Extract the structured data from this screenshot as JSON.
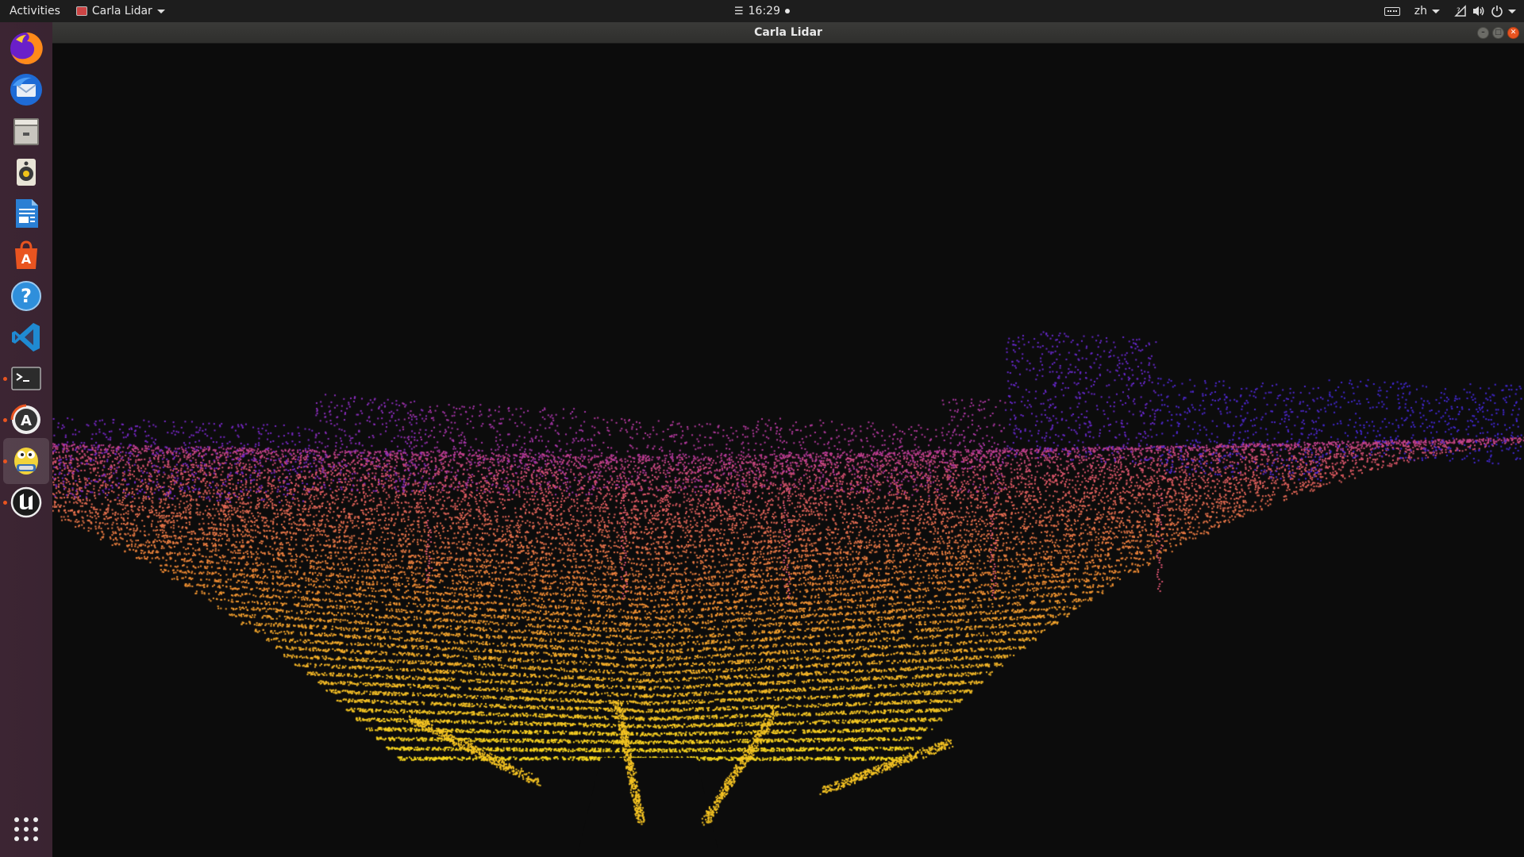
{
  "topbar": {
    "activities_label": "Activities",
    "app_menu_label": "Carla Lidar",
    "clock": "16:29",
    "language": "zh"
  },
  "window": {
    "title": "Carla Lidar"
  },
  "dock": {
    "items": [
      {
        "name": "firefox-icon",
        "running": false
      },
      {
        "name": "thunderbird-icon",
        "running": false
      },
      {
        "name": "files-icon",
        "running": false
      },
      {
        "name": "rhythmbox-icon",
        "running": false
      },
      {
        "name": "libreoffice-writer-icon",
        "running": false
      },
      {
        "name": "ubuntu-software-icon",
        "running": false
      },
      {
        "name": "help-icon",
        "running": false
      },
      {
        "name": "vscode-icon",
        "running": false
      },
      {
        "name": "terminal-icon",
        "running": true
      },
      {
        "name": "software-updater-icon",
        "running": true
      },
      {
        "name": "python-app-icon",
        "running": true,
        "active": true
      },
      {
        "name": "unreal-engine-icon",
        "running": true
      }
    ],
    "show_apps_icon": "app-grid-icon"
  },
  "colors": {
    "background": "#0c0c0c",
    "accent": "#e95420",
    "cloud_far": "#3a2bd8",
    "cloud_mid": "#d24a8c",
    "cloud_near": "#f5d21a"
  }
}
